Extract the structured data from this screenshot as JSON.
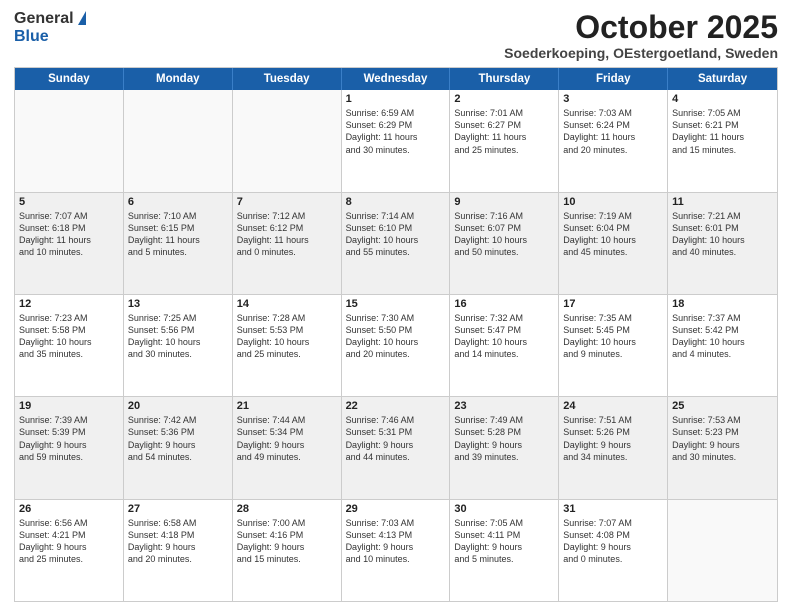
{
  "logo": {
    "general": "General",
    "blue": "Blue"
  },
  "title": "October 2025",
  "location": "Soederkoeping, OEstergoetland, Sweden",
  "days_of_week": [
    "Sunday",
    "Monday",
    "Tuesday",
    "Wednesday",
    "Thursday",
    "Friday",
    "Saturday"
  ],
  "rows": [
    [
      {
        "day": "",
        "info": "",
        "empty": true
      },
      {
        "day": "",
        "info": "",
        "empty": true
      },
      {
        "day": "",
        "info": "",
        "empty": true
      },
      {
        "day": "1",
        "info": "Sunrise: 6:59 AM\nSunset: 6:29 PM\nDaylight: 11 hours\nand 30 minutes."
      },
      {
        "day": "2",
        "info": "Sunrise: 7:01 AM\nSunset: 6:27 PM\nDaylight: 11 hours\nand 25 minutes."
      },
      {
        "day": "3",
        "info": "Sunrise: 7:03 AM\nSunset: 6:24 PM\nDaylight: 11 hours\nand 20 minutes."
      },
      {
        "day": "4",
        "info": "Sunrise: 7:05 AM\nSunset: 6:21 PM\nDaylight: 11 hours\nand 15 minutes."
      }
    ],
    [
      {
        "day": "5",
        "info": "Sunrise: 7:07 AM\nSunset: 6:18 PM\nDaylight: 11 hours\nand 10 minutes."
      },
      {
        "day": "6",
        "info": "Sunrise: 7:10 AM\nSunset: 6:15 PM\nDaylight: 11 hours\nand 5 minutes."
      },
      {
        "day": "7",
        "info": "Sunrise: 7:12 AM\nSunset: 6:12 PM\nDaylight: 11 hours\nand 0 minutes."
      },
      {
        "day": "8",
        "info": "Sunrise: 7:14 AM\nSunset: 6:10 PM\nDaylight: 10 hours\nand 55 minutes."
      },
      {
        "day": "9",
        "info": "Sunrise: 7:16 AM\nSunset: 6:07 PM\nDaylight: 10 hours\nand 50 minutes."
      },
      {
        "day": "10",
        "info": "Sunrise: 7:19 AM\nSunset: 6:04 PM\nDaylight: 10 hours\nand 45 minutes."
      },
      {
        "day": "11",
        "info": "Sunrise: 7:21 AM\nSunset: 6:01 PM\nDaylight: 10 hours\nand 40 minutes."
      }
    ],
    [
      {
        "day": "12",
        "info": "Sunrise: 7:23 AM\nSunset: 5:58 PM\nDaylight: 10 hours\nand 35 minutes."
      },
      {
        "day": "13",
        "info": "Sunrise: 7:25 AM\nSunset: 5:56 PM\nDaylight: 10 hours\nand 30 minutes."
      },
      {
        "day": "14",
        "info": "Sunrise: 7:28 AM\nSunset: 5:53 PM\nDaylight: 10 hours\nand 25 minutes."
      },
      {
        "day": "15",
        "info": "Sunrise: 7:30 AM\nSunset: 5:50 PM\nDaylight: 10 hours\nand 20 minutes."
      },
      {
        "day": "16",
        "info": "Sunrise: 7:32 AM\nSunset: 5:47 PM\nDaylight: 10 hours\nand 14 minutes."
      },
      {
        "day": "17",
        "info": "Sunrise: 7:35 AM\nSunset: 5:45 PM\nDaylight: 10 hours\nand 9 minutes."
      },
      {
        "day": "18",
        "info": "Sunrise: 7:37 AM\nSunset: 5:42 PM\nDaylight: 10 hours\nand 4 minutes."
      }
    ],
    [
      {
        "day": "19",
        "info": "Sunrise: 7:39 AM\nSunset: 5:39 PM\nDaylight: 9 hours\nand 59 minutes."
      },
      {
        "day": "20",
        "info": "Sunrise: 7:42 AM\nSunset: 5:36 PM\nDaylight: 9 hours\nand 54 minutes."
      },
      {
        "day": "21",
        "info": "Sunrise: 7:44 AM\nSunset: 5:34 PM\nDaylight: 9 hours\nand 49 minutes."
      },
      {
        "day": "22",
        "info": "Sunrise: 7:46 AM\nSunset: 5:31 PM\nDaylight: 9 hours\nand 44 minutes."
      },
      {
        "day": "23",
        "info": "Sunrise: 7:49 AM\nSunset: 5:28 PM\nDaylight: 9 hours\nand 39 minutes."
      },
      {
        "day": "24",
        "info": "Sunrise: 7:51 AM\nSunset: 5:26 PM\nDaylight: 9 hours\nand 34 minutes."
      },
      {
        "day": "25",
        "info": "Sunrise: 7:53 AM\nSunset: 5:23 PM\nDaylight: 9 hours\nand 30 minutes."
      }
    ],
    [
      {
        "day": "26",
        "info": "Sunrise: 6:56 AM\nSunset: 4:21 PM\nDaylight: 9 hours\nand 25 minutes."
      },
      {
        "day": "27",
        "info": "Sunrise: 6:58 AM\nSunset: 4:18 PM\nDaylight: 9 hours\nand 20 minutes."
      },
      {
        "day": "28",
        "info": "Sunrise: 7:00 AM\nSunset: 4:16 PM\nDaylight: 9 hours\nand 15 minutes."
      },
      {
        "day": "29",
        "info": "Sunrise: 7:03 AM\nSunset: 4:13 PM\nDaylight: 9 hours\nand 10 minutes."
      },
      {
        "day": "30",
        "info": "Sunrise: 7:05 AM\nSunset: 4:11 PM\nDaylight: 9 hours\nand 5 minutes."
      },
      {
        "day": "31",
        "info": "Sunrise: 7:07 AM\nSunset: 4:08 PM\nDaylight: 9 hours\nand 0 minutes."
      },
      {
        "day": "",
        "info": "",
        "empty": true
      }
    ]
  ]
}
